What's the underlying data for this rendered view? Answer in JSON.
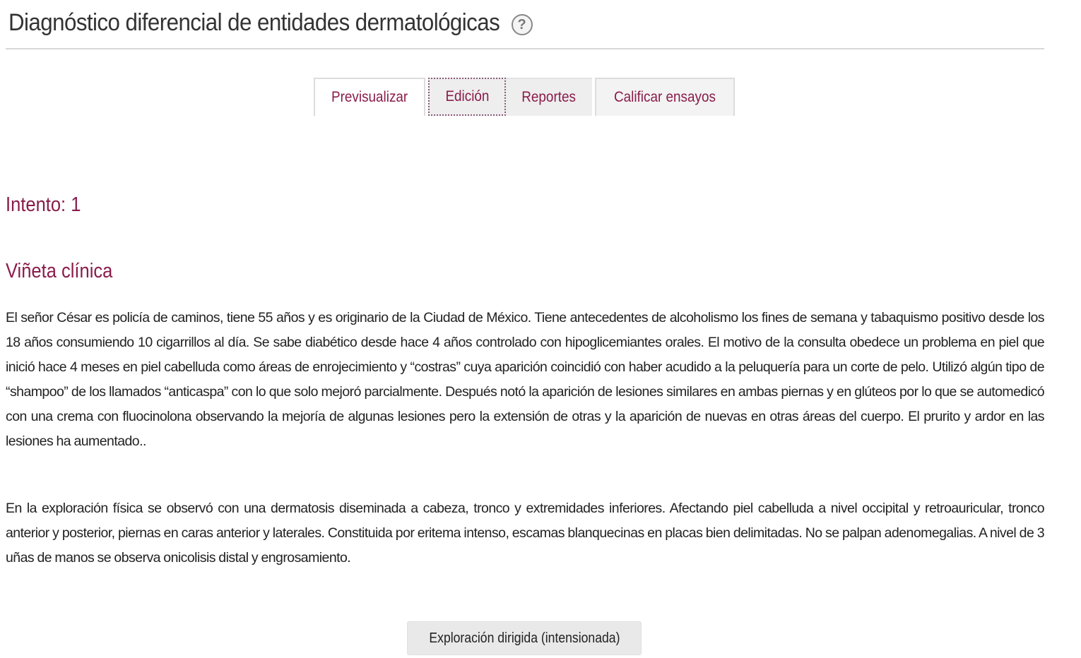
{
  "header": {
    "title": "Diagnóstico diferencial de entidades dermatológicas",
    "help_icon": "?"
  },
  "tabs": [
    {
      "label": "Previsualizar",
      "active": true
    },
    {
      "label": "Edición",
      "focused": true
    },
    {
      "label": "Reportes"
    },
    {
      "label": "Calificar ensayos"
    }
  ],
  "attempt": {
    "label": "Intento: 1"
  },
  "section": {
    "title": "Viñeta clínica",
    "paragraphs": [
      "El señor César es policía de caminos, tiene 55 años y es originario de la Ciudad de México.  Tiene antecedentes de alcoholismo los fines de semana y tabaquismo positivo desde los 18 años consumiendo 10 cigarrillos al día. Se sabe diabético desde hace 4 años controlado con hipoglicemiantes orales. El motivo de la consulta obedece un problema en  piel  que inició hace 4 meses en piel cabelluda como áreas de enrojecimiento y “costras”  cuya aparición coincidió con haber acudido a la peluquería para un corte de pelo.  Utilizó algún tipo de “shampoo” de los llamados “anticaspa” con lo que solo mejoró parcialmente. Después notó la aparición de lesiones similares en ambas piernas y en glúteos por lo que se automedicó con una crema con fluocinolona  observando la mejoría de algunas lesiones pero la extensión de otras y la aparición de nuevas en otras áreas del cuerpo. El prurito y ardor en las lesiones ha aumentado..",
      "En la exploración física se observó con una dermatosis diseminada a cabeza, tronco y extremidades inferiores. Afectando piel cabelluda a nivel occipital y retroauricular, tronco anterior y posterior, piernas en caras anterior y laterales. Constituida por eritema intenso, escamas blanquecinas en placas bien delimitadas.  No se palpan adenomegalias. A nivel de 3 uñas de manos se observa onicolisis distal y engrosamiento."
    ]
  },
  "actions": {
    "directed_exploration_label": "Exploración dirigida (intensionada)"
  },
  "colors": {
    "accent": "#8a1c4a",
    "text": "#222222",
    "tab_background": "#eeeeee"
  }
}
